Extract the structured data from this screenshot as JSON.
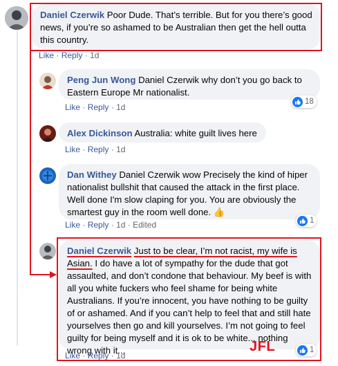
{
  "comments": [
    {
      "author": "Daniel Czerwik",
      "text": "Poor Dude. That’s terrible. But for you there’s good news, if you’re so ashamed to be Australian then get the hell outta this country.",
      "like": "Like",
      "reply": "Reply",
      "time": "1d"
    }
  ],
  "replies": [
    {
      "author": "Peng Jun Wong",
      "text": "Daniel Czerwik why don’t you go back to Eastern Europe Mr nationalist.",
      "like": "Like",
      "reply": "Reply",
      "time": "1d",
      "reactions": "18"
    },
    {
      "author": "Alex Dickinson",
      "text": "Australia: white guilt lives here",
      "like": "Like",
      "reply": "Reply",
      "time": "1d"
    },
    {
      "author": "Dan Withey",
      "text": "Daniel Czerwik wow Precisely the kind of hiper nationalist bullshit that caused the attack in the first place. Well done I'm slow claping for you. You are obviously the smartest guy in the room well done. 👍",
      "like": "Like",
      "reply": "Reply",
      "time": "1d",
      "edited": "Edited",
      "reactions": "1"
    },
    {
      "author": "Daniel Czerwik",
      "text_underlined": "Just to be clear, I’m not racist, my wife is Asian.",
      "text": "I do have a lot of sympathy for the dude that got assaulted, and don’t condone that behaviour. My beef is with all you white fuckers who feel shame for being white Australians. If you’re innocent, you have nothing to be guilty of or ashamed. And if you can’t help to feel that and still hate yourselves then go and kill yourselves. I’m not going to feel guilty for being myself and it is ok to be white... nothing wrong with it...",
      "like": "Like",
      "reply": "Reply",
      "time": "1d",
      "reactions": "1"
    }
  ],
  "annotation": "JFL",
  "separator": "·",
  "colors": {
    "accent_red": "#e0141e",
    "name_blue": "#385898",
    "like_blue": "#1877f2",
    "bubble_bg": "#f0f2f5"
  }
}
